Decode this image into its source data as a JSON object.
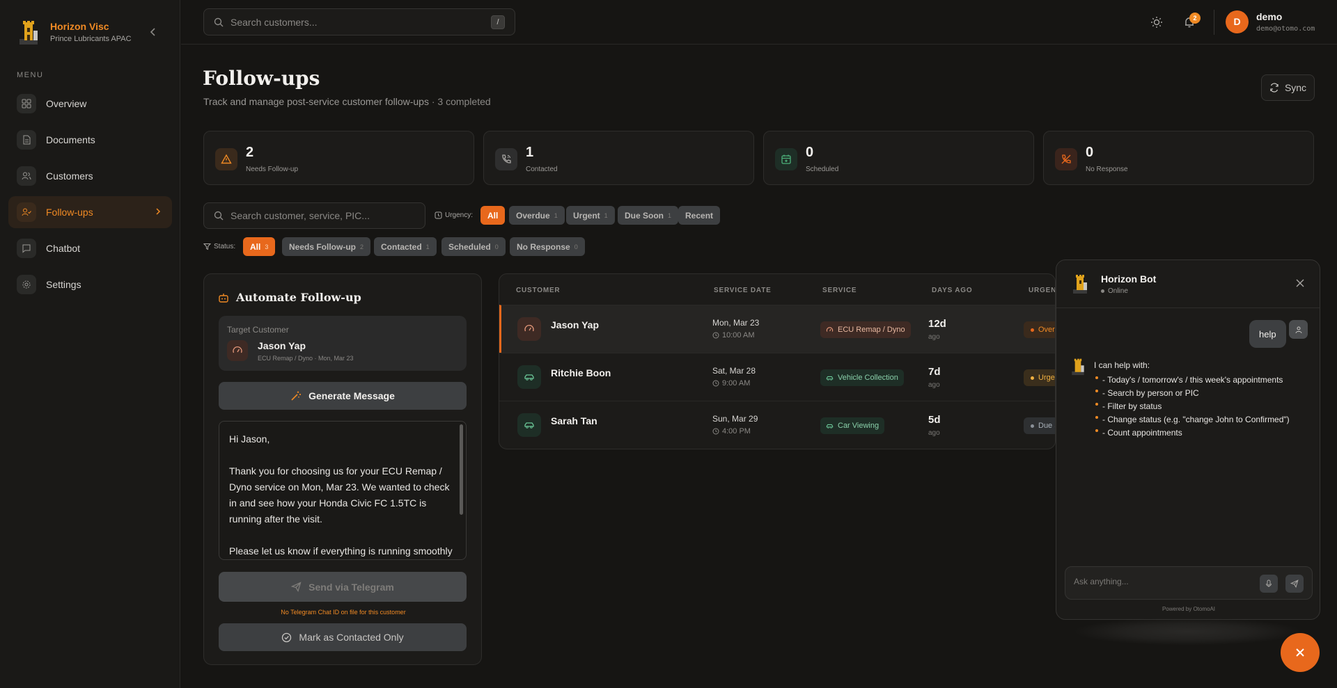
{
  "brand": {
    "name": "Horizon Visc",
    "subtitle": "Prince Lubricants APAC"
  },
  "sidebar": {
    "menu_label": "MENU",
    "items": [
      {
        "label": "Overview",
        "icon": "grid-icon"
      },
      {
        "label": "Documents",
        "icon": "document-icon"
      },
      {
        "label": "Customers",
        "icon": "users-icon"
      },
      {
        "label": "Follow-ups",
        "icon": "user-check-icon",
        "active": true
      },
      {
        "label": "Chatbot",
        "icon": "chat-icon"
      },
      {
        "label": "Settings",
        "icon": "gear-icon"
      }
    ]
  },
  "topbar": {
    "search_placeholder": "Search customers...",
    "search_shortcut": "/",
    "notification_count": "2",
    "user": {
      "initial": "D",
      "name": "demo",
      "email": "demo@otomo.com"
    }
  },
  "page": {
    "title": "Follow-ups",
    "subtitle": "Track and manage post-service customer follow-ups",
    "completed": "· 3 completed",
    "sync_label": "Sync"
  },
  "stats": [
    {
      "value": "2",
      "label": "Needs Follow-up",
      "color": "#f08a24"
    },
    {
      "value": "1",
      "label": "Contacted",
      "color": "#a8a6a3"
    },
    {
      "value": "0",
      "label": "Scheduled",
      "color": "#4cb07a"
    },
    {
      "value": "0",
      "label": "No Response",
      "color": "#e8681c"
    }
  ],
  "filters": {
    "search_placeholder": "Search customer, service, PIC...",
    "urgency_label": "Urgency:",
    "urgency": [
      {
        "label": "All",
        "count": ""
      },
      {
        "label": "Overdue",
        "count": "1"
      },
      {
        "label": "Urgent",
        "count": "1"
      },
      {
        "label": "Due Soon",
        "count": "1"
      },
      {
        "label": "Recent",
        "count": ""
      }
    ],
    "status_label": "Status:",
    "status": [
      {
        "label": "All",
        "count": "3"
      },
      {
        "label": "Needs Follow-up",
        "count": "2"
      },
      {
        "label": "Contacted",
        "count": "1"
      },
      {
        "label": "Scheduled",
        "count": "0"
      },
      {
        "label": "No Response",
        "count": "0"
      }
    ]
  },
  "automate": {
    "title": "Automate Follow-up",
    "target_label": "Target Customer",
    "target_name": "Jason Yap",
    "target_meta": "ECU Remap / Dyno · Mon, Mar 23",
    "generate_label": "Generate Message",
    "message": "Hi Jason,\n\nThank you for choosing us for your ECU Remap / Dyno service on Mon, Mar 23. We wanted to check in and see how your Honda Civic FC 1.5TC is running after the visit.\n\nPlease let us know if everything is running smoothly",
    "telegram_label": "Send via Telegram",
    "telegram_note": "No Telegram Chat ID on file for this customer",
    "contacted_label": "Mark as Contacted Only"
  },
  "table": {
    "headers": [
      "CUSTOMER",
      "SERVICE DATE",
      "SERVICE",
      "DAYS AGO",
      "URGENCY"
    ],
    "rows": [
      {
        "name": "Jason Yap",
        "date": "Mon, Mar 23",
        "time": "10:00 AM",
        "service": "ECU Remap / Dyno",
        "days": "12d",
        "ago": "ago",
        "urgency": "Overdue",
        "icon": "gauge-icon"
      },
      {
        "name": "Ritchie Boon",
        "date": "Sat, Mar 28",
        "time": "9:00 AM",
        "service": "Vehicle Collection",
        "days": "7d",
        "ago": "ago",
        "urgency": "Urgent",
        "icon": "car-icon"
      },
      {
        "name": "Sarah Tan",
        "date": "Sun, Mar 29",
        "time": "4:00 PM",
        "service": "Car Viewing",
        "days": "5d",
        "ago": "ago",
        "urgency": "Due Soon",
        "icon": "car-icon"
      }
    ]
  },
  "chat": {
    "bot_name": "Horizon Bot",
    "status": "Online",
    "user_message": "help",
    "bot_intro": "I can help with:",
    "bot_items": [
      "- Today's / tomorrow's / this week's appointments",
      "- Search by person or PIC",
      "- Filter by status",
      "- Change status (e.g. \"change John to Confirmed\")",
      "- Count appointments"
    ],
    "input_placeholder": "Ask anything...",
    "powered_by": "Powered by OtomoAI"
  },
  "colors": {
    "accent": "#e8681c",
    "brand": "#f08a24",
    "success": "#4cb07a"
  }
}
